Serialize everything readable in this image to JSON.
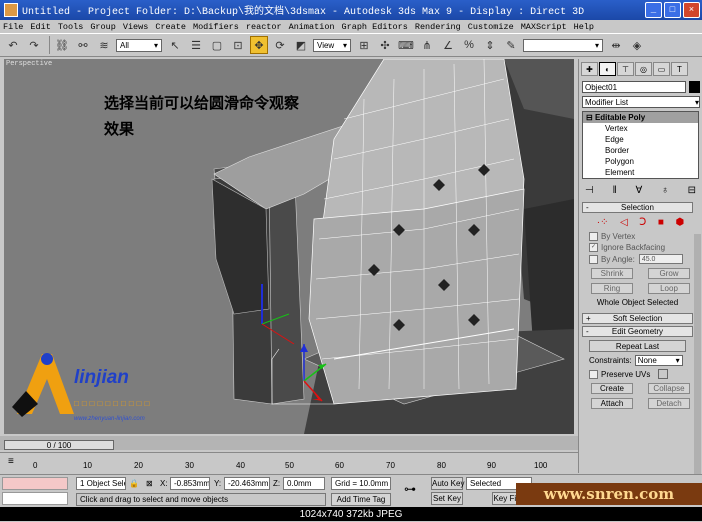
{
  "titlebar": {
    "title": "Untitled   - Project Folder: D:\\Backup\\我的文档\\3dsmax   - Autodesk 3ds Max 9   - Display : Direct 3D"
  },
  "menu": {
    "items": [
      "File",
      "Edit",
      "Tools",
      "Group",
      "Views",
      "Create",
      "Modifiers",
      "reactor",
      "Animation",
      "Graph Editors",
      "Rendering",
      "Customize",
      "MAXScript",
      "Help"
    ]
  },
  "toolbar": {
    "selection_filter": "All",
    "ref_coord": "View"
  },
  "viewport": {
    "label": "Perspective",
    "caption_line1": "选择当前可以给圆滑命令观察",
    "caption_line2": "效果"
  },
  "logo": {
    "brand": "linjian",
    "cn": "□□□□□□□□□□",
    "url": "www.zhenyuan-linjian.com"
  },
  "command_panel": {
    "object_name": "Object01",
    "object_color": "#000000",
    "modifier_list": "Modifier List",
    "stack_root": "Editable Poly",
    "stack_items": [
      "Vertex",
      "Edge",
      "Border",
      "Polygon",
      "Element"
    ],
    "selection": {
      "title": "Selection",
      "by_vertex": "By Vertex",
      "ignore_backfacing": "Ignore Backfacing",
      "by_angle": "By Angle:",
      "angle_value": "45.0",
      "shrink": "Shrink",
      "grow": "Grow",
      "ring": "Ring",
      "loop": "Loop",
      "status": "Whole Object Selected"
    },
    "soft_selection": "Soft Selection",
    "edit_geometry": {
      "title": "Edit Geometry",
      "repeat_last": "Repeat Last",
      "constraints_label": "Constraints:",
      "constraints_value": "None",
      "preserve_uvs": "Preserve UVs",
      "create": "Create",
      "collapse": "Collapse",
      "attach": "Attach",
      "detach": "Detach"
    }
  },
  "timeline": {
    "slider_text": "0 / 100",
    "ticks": [
      "0",
      "10",
      "20",
      "30",
      "40",
      "50",
      "60",
      "70",
      "80",
      "90",
      "100"
    ]
  },
  "status": {
    "selection_count": "1 Object Sele",
    "x_label": "X:",
    "x_value": "-0.853mm",
    "y_label": "Y:",
    "y_value": "-20.463mm",
    "z_label": "Z:",
    "z_value": "0.0mm",
    "grid": "Grid = 10.0mm",
    "prompt": "Click and drag to select and move objects",
    "add_time_tag": "Add Time Tag",
    "auto_key": "Auto Key",
    "set_key": "Set Key",
    "selected_dropdown": "Selected",
    "key_filters": "Key Filte"
  },
  "watermark": "www.snren.com",
  "image_info": "1024x740  372kb  JPEG"
}
